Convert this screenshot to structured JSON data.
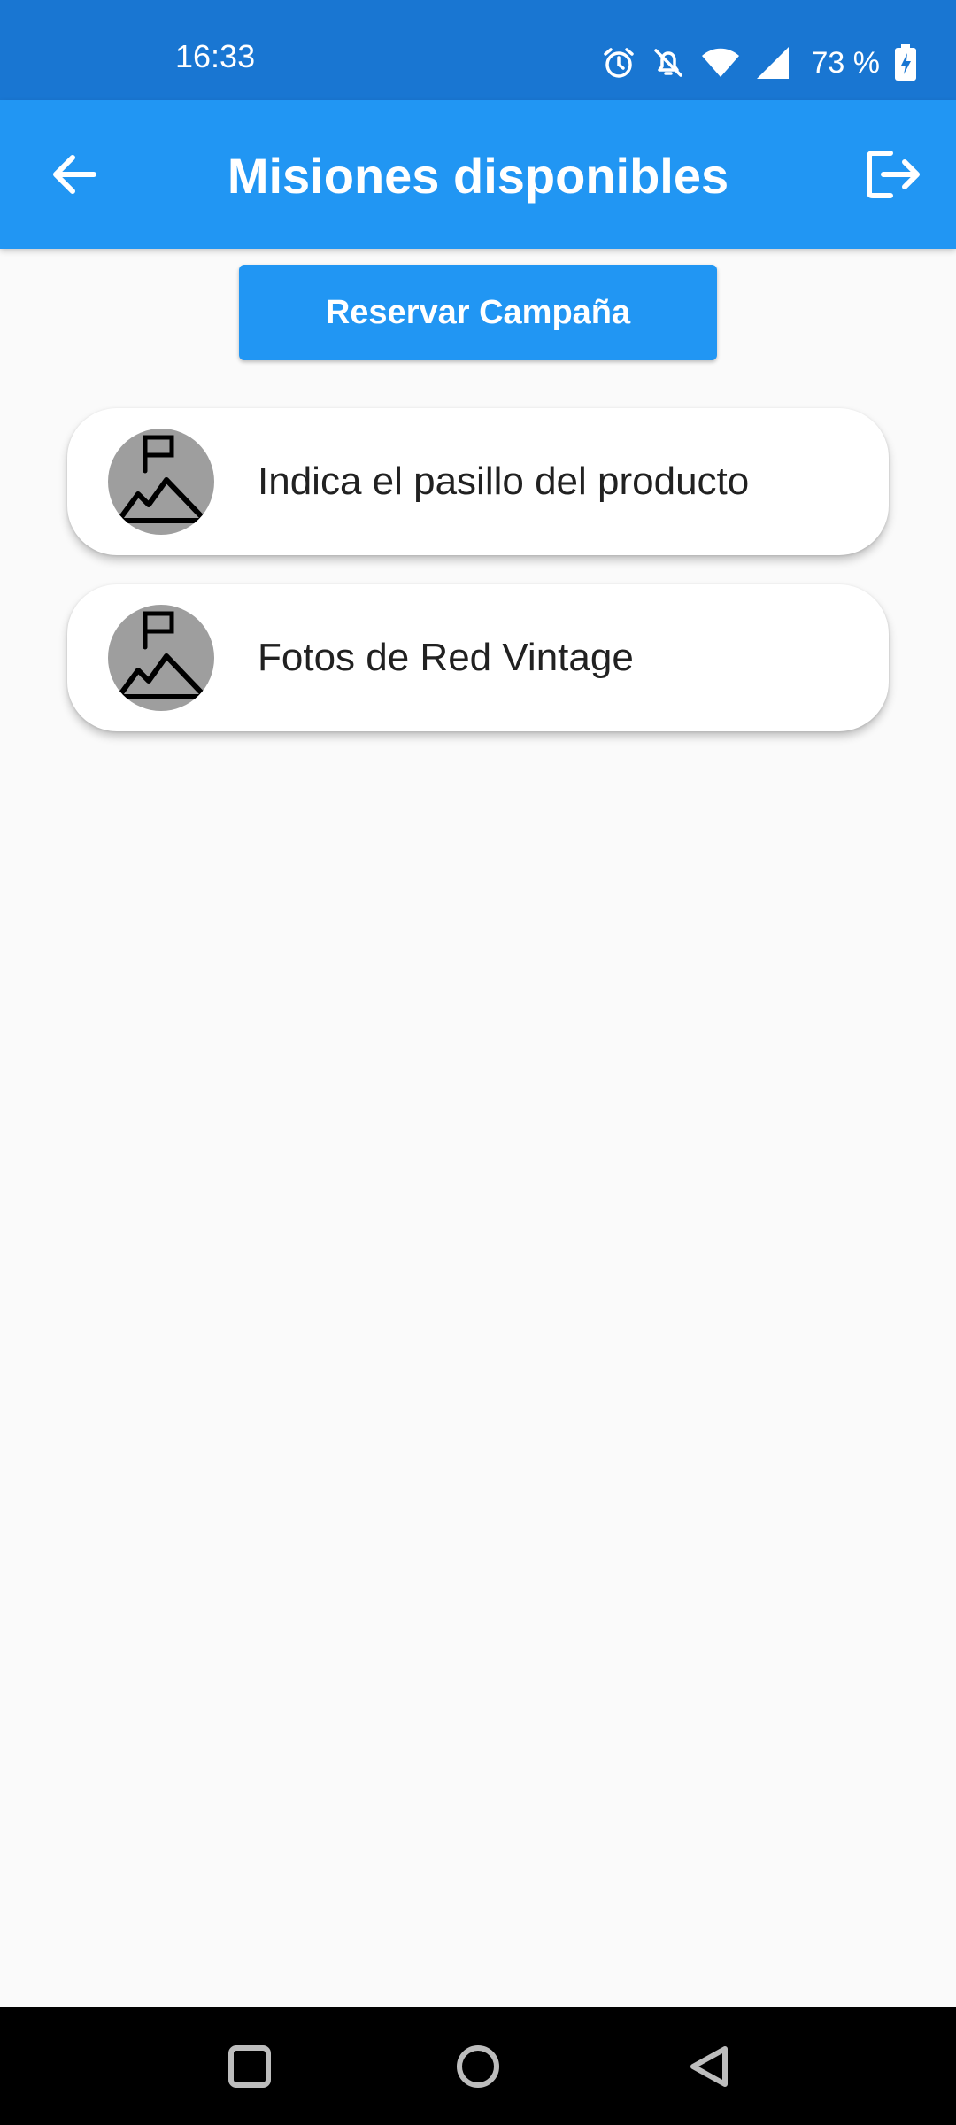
{
  "status_bar": {
    "time": "16:33",
    "battery": "73 %",
    "icons": [
      "alarm-icon",
      "bell-off-icon",
      "wifi-icon",
      "signal-icon",
      "battery-charging-icon"
    ]
  },
  "app_bar": {
    "title": "Misiones disponibles",
    "back_icon": "arrow-left-icon",
    "logout_icon": "logout-icon"
  },
  "actions": {
    "reserve_label": "Reservar Campaña"
  },
  "missions": [
    {
      "title": "Indica el pasillo del producto",
      "icon": "mountain-flag-icon"
    },
    {
      "title": "Fotos de Red Vintage",
      "icon": "mountain-flag-icon"
    }
  ],
  "nav_bar": {
    "buttons": [
      "recents-icon",
      "home-icon",
      "back-icon"
    ]
  },
  "colors": {
    "status_bar": "#1976D2",
    "app_bar": "#2196F3",
    "background": "#FAFAFA",
    "avatar": "#9E9E9E",
    "nav_bar": "#000000"
  }
}
